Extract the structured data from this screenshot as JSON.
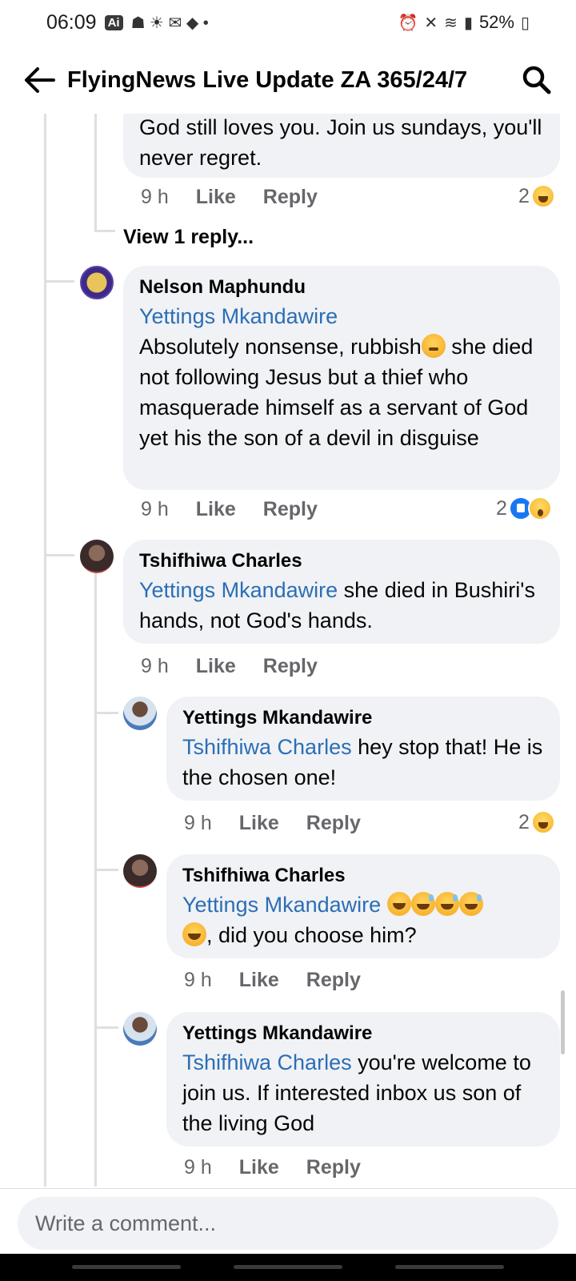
{
  "status_bar": {
    "time": "06:09",
    "ai_badge": "Ai",
    "battery": "52%"
  },
  "header": {
    "title": "FlyingNews Live Update ZA 365/24/7",
    "back_icon": "arrow-left-icon",
    "search_icon": "search-icon"
  },
  "comments": [
    {
      "id": "c0",
      "text": "God still loves you. Join us sundays, you'll never regret.",
      "time": "9 h",
      "like": "Like",
      "reply": "Reply",
      "reaction_count": "2",
      "reactions": [
        "haha"
      ],
      "view_replies": "View 1 reply..."
    },
    {
      "id": "c1",
      "author": "Nelson Maphundu",
      "mention": "Yettings Mkandawire",
      "text_a": "Absolutely nonsense, rubbish",
      "text_b": " she died not following Jesus but a thief who masquerade himself as a servant of God yet his the son of a devil in disguise",
      "time": "9 h",
      "like": "Like",
      "reply": "Reply",
      "reaction_count": "2",
      "reactions": [
        "like",
        "wow"
      ]
    },
    {
      "id": "c2",
      "author": "Tshifhiwa Charles",
      "mention": "Yettings Mkandawire",
      "text": " she died in Bushiri's hands, not God's hands.",
      "time": "9 h",
      "like": "Like",
      "reply": "Reply"
    },
    {
      "id": "c3",
      "author": "Yettings Mkandawire",
      "mention": "Tshifhiwa Charles",
      "text": " hey stop that! He is the chosen one!",
      "time": "9 h",
      "like": "Like",
      "reply": "Reply",
      "reaction_count": "2",
      "reactions": [
        "haha"
      ]
    },
    {
      "id": "c4",
      "author": "Tshifhiwa Charles",
      "mention": "Yettings Mkandawire",
      "text": ", did you choose him?",
      "time": "9 h",
      "like": "Like",
      "reply": "Reply"
    },
    {
      "id": "c5",
      "author": "Yettings Mkandawire",
      "mention": "Tshifhiwa Charles",
      "text": " you're welcome to join us. If interested inbox us son of the living God",
      "time": "9 h",
      "like": "Like",
      "reply": "Reply"
    }
  ],
  "composer": {
    "placeholder": "Write a comment..."
  }
}
